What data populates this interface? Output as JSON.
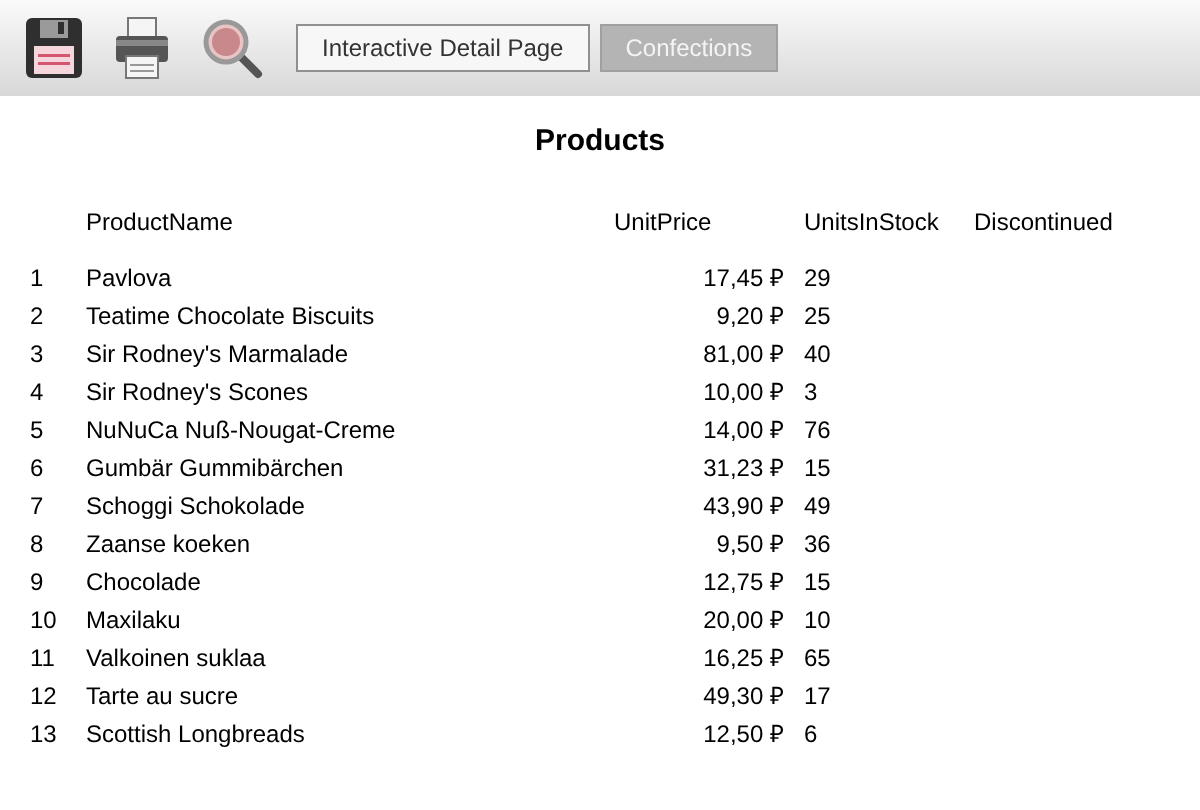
{
  "toolbar": {
    "breadcrumbs": [
      {
        "label": "Interactive Detail Page",
        "selected": false
      },
      {
        "label": "Confections",
        "selected": true
      }
    ]
  },
  "report": {
    "title": "Products",
    "columns": [
      "ProductName",
      "UnitPrice",
      "UnitsInStock",
      "Discontinued"
    ],
    "rows": [
      {
        "index": "1",
        "name": "Pavlova",
        "price": "17,45 ₽",
        "stock": "29"
      },
      {
        "index": "2",
        "name": "Teatime Chocolate Biscuits",
        "price": "9,20 ₽",
        "stock": "25"
      },
      {
        "index": "3",
        "name": "Sir Rodney's Marmalade",
        "price": "81,00 ₽",
        "stock": "40"
      },
      {
        "index": "4",
        "name": "Sir Rodney's Scones",
        "price": "10,00 ₽",
        "stock": "3"
      },
      {
        "index": "5",
        "name": "NuNuCa Nuß-Nougat-Creme",
        "price": "14,00 ₽",
        "stock": "76"
      },
      {
        "index": "6",
        "name": "Gumbär Gummibärchen",
        "price": "31,23 ₽",
        "stock": "15"
      },
      {
        "index": "7",
        "name": "Schoggi Schokolade",
        "price": "43,90 ₽",
        "stock": "49"
      },
      {
        "index": "8",
        "name": "Zaanse koeken",
        "price": "9,50 ₽",
        "stock": "36"
      },
      {
        "index": "9",
        "name": "Chocolade",
        "price": "12,75 ₽",
        "stock": "15"
      },
      {
        "index": "10",
        "name": "Maxilaku",
        "price": "20,00 ₽",
        "stock": "10"
      },
      {
        "index": "11",
        "name": "Valkoinen suklaa",
        "price": "16,25 ₽",
        "stock": "65"
      },
      {
        "index": "12",
        "name": "Tarte au sucre",
        "price": "49,30 ₽",
        "stock": "17"
      },
      {
        "index": "13",
        "name": "Scottish Longbreads",
        "price": "12,50 ₽",
        "stock": "6"
      }
    ]
  }
}
